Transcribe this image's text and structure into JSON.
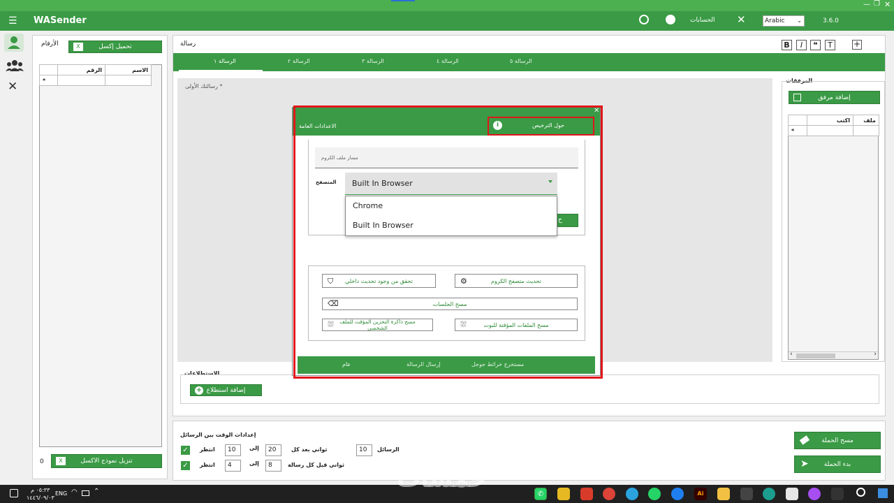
{
  "app": {
    "title": "WASender",
    "version": "3.6.0",
    "language": "Arabic"
  },
  "titlebar": {
    "accounts_label": "الحسابات"
  },
  "numbers_panel": {
    "title": "الأرقام",
    "upload_excel": "تحميل إكسل",
    "columns": [
      "الاسم",
      "الرقم"
    ],
    "new_row_marker": "*",
    "download_template": "تنزيل نموذج الاكسل",
    "count": "0"
  },
  "message": {
    "label": "رسالة",
    "tabs": [
      "الرسالة ١",
      "الرسالة ٢",
      "الرسالة ٣",
      "الرسالة ٤",
      "الرسالة ٥"
    ],
    "placeholder": "رسالتك الأولى *"
  },
  "attachments": {
    "title": "المرفقات",
    "add_button": "إضافة مرفق",
    "columns": [
      "ملف",
      "اكتب"
    ],
    "new_row_marker": "*"
  },
  "polls": {
    "title": "الاستطلاعات",
    "add_button": "إضافة استطلاع"
  },
  "timing": {
    "title": "إعدادات الوقت بين الرسائل",
    "row1": {
      "wait": "انتظر",
      "from": "10",
      "to_label": "إلى",
      "to": "20",
      "unit": "ثواني بعد كل",
      "count": "10",
      "count_label": "الرسائل"
    },
    "row2": {
      "wait": "انتظر",
      "from": "4",
      "to_label": "إلى",
      "to": "8",
      "unit": "ثواني قبل كل رسالة"
    }
  },
  "campaign": {
    "clear": "مسح الحملة",
    "start": "بدء الحملة"
  },
  "dialog": {
    "tab_general": "الاعدادات العامة",
    "tab_license": "حول الترخيص",
    "chrome_path_placeholder": "مسار ملف الكروم",
    "browser_label": "المتصفح",
    "browser_selected": "Built In Browser",
    "browser_options": [
      "Chrome",
      "Built In Browser"
    ],
    "hidden_button_fragment": "ح",
    "buttons": {
      "update_chrome": "تحديث متصفح الكروم",
      "check_update": "تحقق من وجود تحديث داخلي",
      "clear_sessions": "مسح الجلسات",
      "clear_bot_cache": "مسح الملفات المؤقتة للبوت",
      "clear_profile_cache": "مسح ذاكرة التخزين المؤقت للملف الشخصي"
    },
    "bottom_tabs": [
      "عام",
      "إرسال الرسالة",
      "مستخرج خرائط جوجل"
    ]
  },
  "taskbar": {
    "lang": "ENG",
    "time": "٠٥:٣٣ م",
    "date": "١٤٤٦/٠٩/٠٣",
    "watermark": "خمسات"
  },
  "colors": {
    "accent": "#3a9a45",
    "highlight": "#e0151b"
  }
}
